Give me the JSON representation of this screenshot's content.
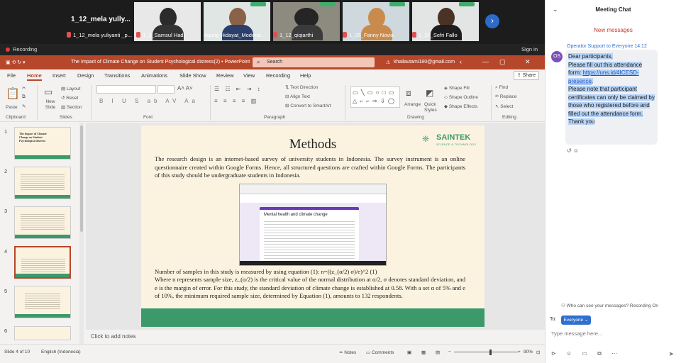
{
  "meeting": {
    "host_name": "1_12_mela yully...",
    "participants": [
      {
        "label": "1_12_mela yuliyanti _p..."
      },
      {
        "label": "1_3_Samsul Hadi"
      },
      {
        "label": "Agung Hidayat_Moderat..."
      },
      {
        "label": "1_12_qiqiarthi"
      },
      {
        "label": "1_25_Fanny Novia"
      },
      {
        "label": "1_20_Sefri Fallo"
      }
    ],
    "recording_label": "Recording",
    "signin_label": "Sign in"
  },
  "ppt": {
    "doc_title": "The Impact of Climate Change on Student Psychological distress(2) • PowerPoint",
    "search_placeholder": "Search",
    "account": "khailautami180@gmail.com",
    "tabs": [
      "File",
      "Home",
      "Insert",
      "Design",
      "Transitions",
      "Animations",
      "Slide Show",
      "Review",
      "View",
      "Recording",
      "Help"
    ],
    "share_label": "Share",
    "ribbon": {
      "clipboard": "Clipboard",
      "slides": "Slides",
      "font": "Font",
      "paragraph": "Paragraph",
      "drawing": "Drawing",
      "editing": "Editing",
      "paste": "Paste",
      "new_slide": "New Slide",
      "layout": "Layout",
      "reset": "Reset",
      "section": "Section",
      "text_direction": "Text Direction",
      "align_text": "Align Text",
      "convert_smartart": "Convert to SmartArt",
      "arrange": "Arrange",
      "quick_styles": "Quick Styles",
      "shape_fill": "Shape Fill",
      "shape_outline": "Shape Outline",
      "shape_effects": "Shape Effects",
      "find": "Find",
      "replace": "Replace",
      "select": "Select"
    },
    "thumbnails": [
      {
        "num": "1",
        "title": "The Impact of Climate Change on Student Psychological distress"
      },
      {
        "num": "2",
        "title": ""
      },
      {
        "num": "3",
        "title": ""
      },
      {
        "num": "4",
        "title": ""
      },
      {
        "num": "5",
        "title": ""
      },
      {
        "num": "6",
        "title": ""
      }
    ],
    "slide": {
      "title": "Methods",
      "logo_name": "SAINTEK",
      "logo_sub": "SCIENCE & TECHNOLOGY",
      "para1": "The research design is an internet-based survey of university students in Indonesia. The survey instrument is an online questionnaire created within Google Forms. Hence, all structured questions are crafted within Google Forms. The participants of this study should be undergraduate students in Indonesia.",
      "form_title": "Mental health and climate change",
      "para2": "Number of samples in this study is measured by using equation (1): n=((z_(α/2) σ)/e)^2  (1)",
      "para3": "Where n represents sample size, z_(α/2) is the critical value of the normal distribution at α/2, σ denotes standard deviation, and e is the margin of error. For this study, the standard deviation of climate change is established at 0.58. With a set α of 5% and e of 10%, the minimum required sample size, determined by Equation (1), amounts to 132 respondents."
    },
    "notes_hint": "Click to add notes",
    "status": {
      "slide_count": "Slide 4 of 10",
      "language": "English (Indonesia)",
      "notes": "Notes",
      "comments": "Comments",
      "zoom": "90%"
    }
  },
  "chat": {
    "title": "Meeting Chat",
    "new_messages": "New messages",
    "sender": "Operator Support to Everyone 14:12",
    "avatar": "OS",
    "msg_part1": "Dear participants,",
    "msg_part2": "Please fill out this attendance form: ",
    "msg_link": "https://uns.id/4ICESD-presence",
    "msg_part3": ".",
    "msg_part4": "Please note that participant certificates can only be claimed by those who registered before and filled out the attendance form.",
    "msg_part5": "Thank you",
    "who_can_see": "Who can see your messages? Recording On",
    "to_label": "To:",
    "to_value": "Everyone",
    "input_placeholder": "Type message here..."
  }
}
